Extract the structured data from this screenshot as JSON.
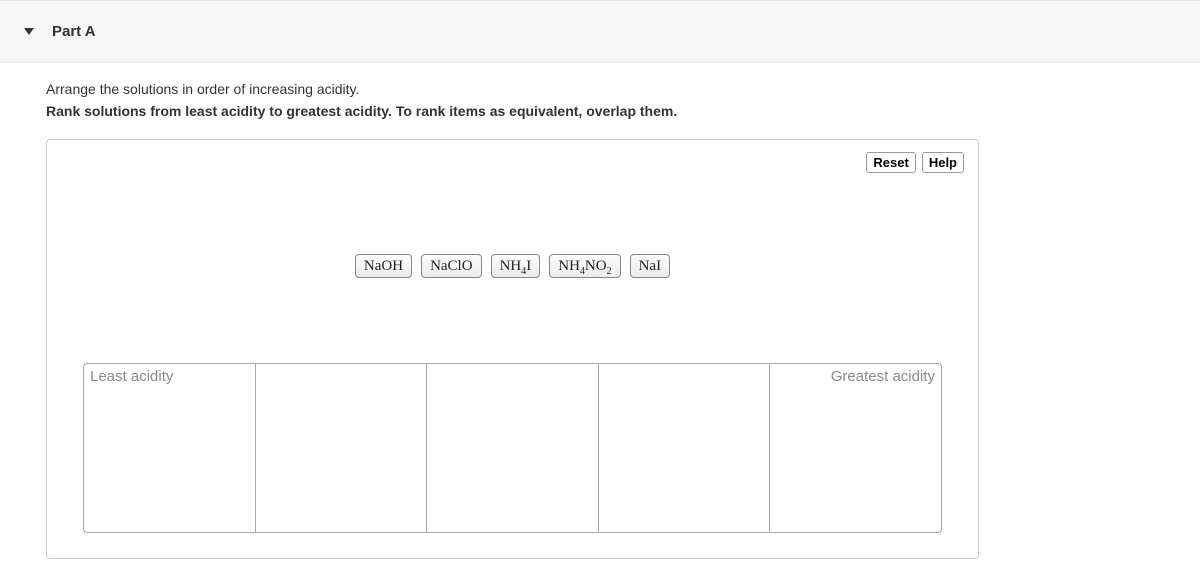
{
  "header": {
    "part_label": "Part A"
  },
  "prompt": "Arrange the solutions in order of increasing acidity.",
  "instructions": "Rank solutions from least acidity to greatest acidity. To rank items as equivalent, overlap them.",
  "buttons": {
    "reset": "Reset",
    "help": "Help"
  },
  "chips": [
    {
      "formula_html": "NaOH"
    },
    {
      "formula_html": "NaClO"
    },
    {
      "formula_html": "NH<sub>4</sub>I"
    },
    {
      "formula_html": "NH<sub>4</sub>NO<sub>2</sub>"
    },
    {
      "formula_html": "NaI"
    }
  ],
  "bins": {
    "count": 5,
    "left_label": "Least acidity",
    "right_label": "Greatest acidity"
  }
}
